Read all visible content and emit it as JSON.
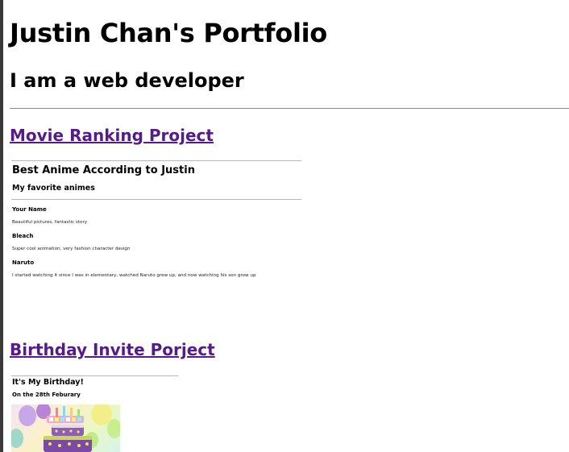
{
  "header": {
    "title": "Justin Chan's Portfolio",
    "subtitle": "I am a web developer"
  },
  "projects": [
    {
      "link_label": "Movie Ranking Project",
      "preview": {
        "heading": "Best Anime According to Justin",
        "subheading": "My favorite animes",
        "items": [
          {
            "name": "Your Name",
            "description": "Beautiful pictures, fantastic story"
          },
          {
            "name": "Bleach",
            "description": "Super cool animation, very fashion character design"
          },
          {
            "name": "Naruto",
            "description": "I started watching it since I was in elementary, watched Naruto grew up, and now watching his son grow up"
          }
        ]
      }
    },
    {
      "link_label": "Birthday Invite Porject",
      "preview": {
        "heading": "It's My Birthday!",
        "subheading": "On the 28th Feburary",
        "image_icon": "birthday-cake-image"
      }
    }
  ],
  "colors": {
    "visited_link": "#551a8b",
    "rule": "#8a8a8a"
  }
}
